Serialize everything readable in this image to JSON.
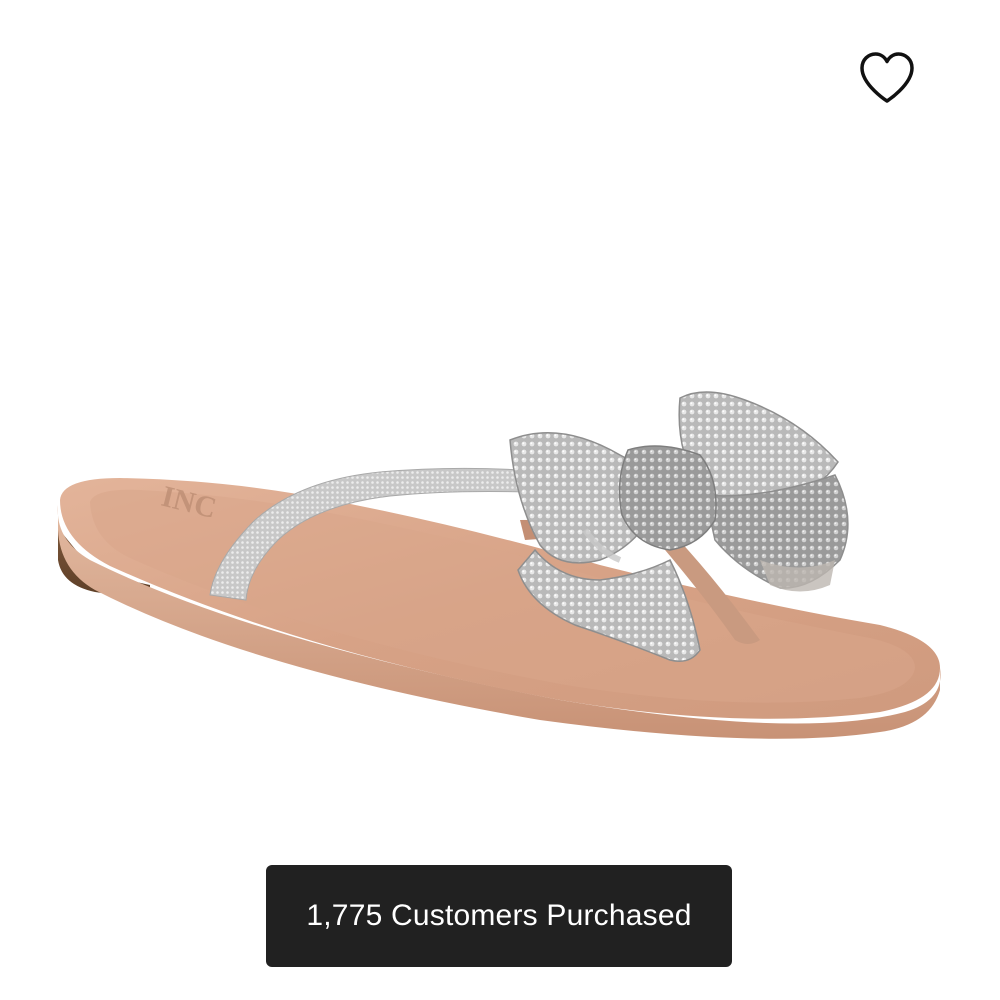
{
  "product": {
    "image_icon": "sandal-with-bow-image",
    "sole_brand_text": "INC",
    "sole_color": "#D9A88C",
    "strap_color": "#C9C9C9"
  },
  "wishlist": {
    "icon": "heart-outline-icon"
  },
  "badge": {
    "text": "1,775 Customers Purchased",
    "background": "#212121",
    "text_color": "#ffffff"
  }
}
